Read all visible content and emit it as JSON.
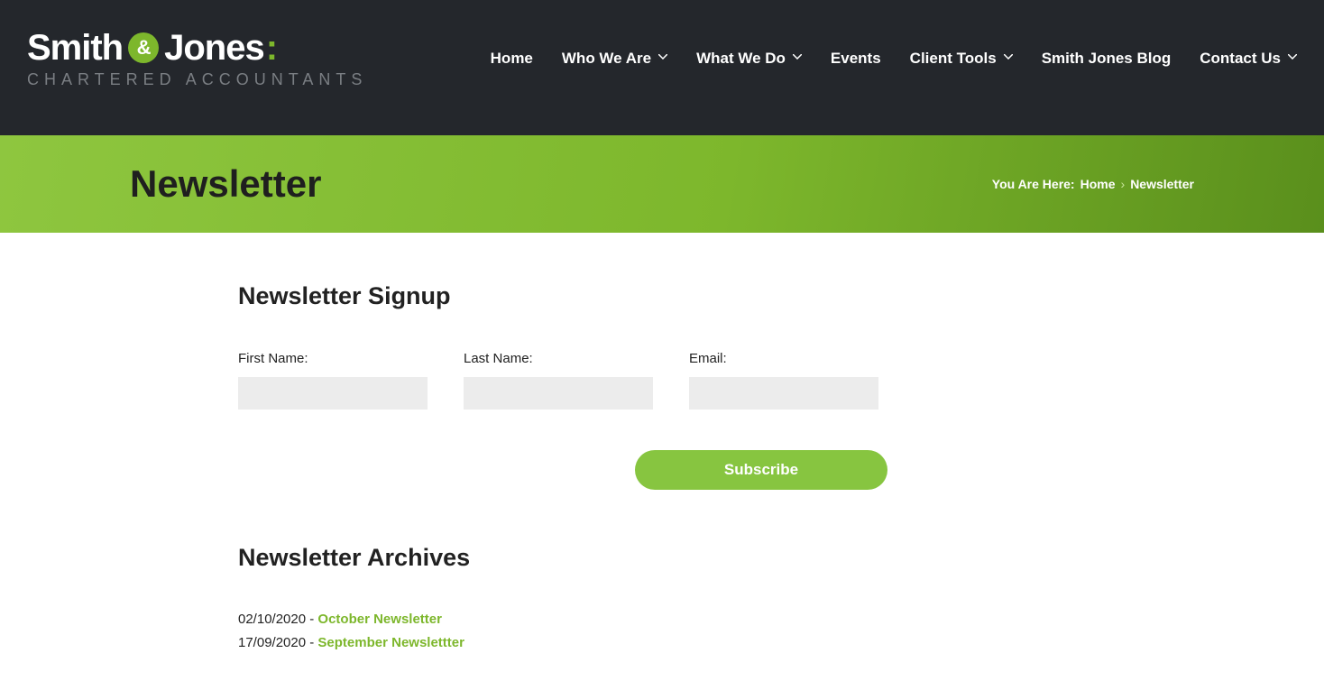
{
  "logo": {
    "name_part1": "Smith",
    "amp": "&",
    "name_part2": "Jones",
    "colon": ":",
    "tagline": "CHARTERED ACCOUNTANTS"
  },
  "nav": {
    "items": [
      {
        "label": "Home",
        "has_dropdown": false
      },
      {
        "label": "Who We Are",
        "has_dropdown": true
      },
      {
        "label": "What We Do",
        "has_dropdown": true
      },
      {
        "label": "Events",
        "has_dropdown": false
      },
      {
        "label": "Client Tools",
        "has_dropdown": true
      },
      {
        "label": "Smith Jones Blog",
        "has_dropdown": false
      },
      {
        "label": "Contact Us",
        "has_dropdown": true
      }
    ]
  },
  "banner": {
    "title": "Newsletter",
    "breadcrumb_prefix": "You Are Here:",
    "breadcrumb_home": "Home",
    "breadcrumb_current": "Newsletter"
  },
  "signup": {
    "heading": "Newsletter Signup",
    "first_name_label": "First Name:",
    "last_name_label": "Last Name:",
    "email_label": "Email:",
    "first_name_value": "",
    "last_name_value": "",
    "email_value": "",
    "subscribe_label": "Subscribe"
  },
  "archives": {
    "heading": "Newsletter Archives",
    "items": [
      {
        "date": "02/10/2020",
        "sep": " - ",
        "title": "October Newsletter"
      },
      {
        "date": "17/09/2020",
        "sep": " - ",
        "title": "September Newslettter"
      }
    ]
  }
}
